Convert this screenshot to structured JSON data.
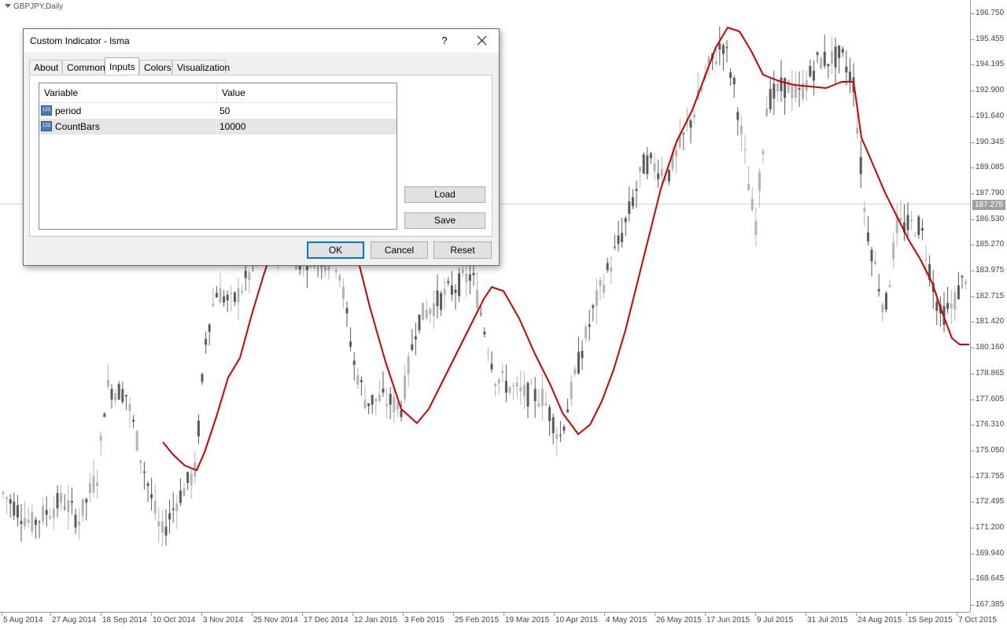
{
  "chart": {
    "symbol": "GBPJPY,Daily",
    "current_price": "187.275",
    "price_axis": [
      "196.750",
      "195.455",
      "194.195",
      "192.900",
      "191.640",
      "190.345",
      "189.085",
      "187.790",
      "186.530",
      "185.270",
      "183.975",
      "182.715",
      "181.420",
      "180.160",
      "178.865",
      "177.605",
      "176.310",
      "175.050",
      "173.755",
      "172.495",
      "171.200",
      "169.940",
      "168.645",
      "167.385"
    ],
    "time_axis": [
      "5 Aug 2014",
      "27 Aug 2014",
      "18 Sep 2014",
      "10 Oct 2014",
      "3 Nov 2014",
      "25 Nov 2014",
      "17 Dec 2014",
      "12 Jan 2015",
      "3 Feb 2015",
      "25 Feb 2015",
      "19 Mar 2015",
      "10 Apr 2015",
      "4 May 2015",
      "26 May 2015",
      "17 Jun 2015",
      "9 Jul 2015",
      "31 Jul 2015",
      "24 Aug 2015",
      "15 Sep 2015",
      "7 Oct 2015"
    ],
    "colors": {
      "candle": "#b4b4b4",
      "candle_bear": "#5a5a5a",
      "indicator": "#d00000",
      "axis": "#9a9a9a"
    }
  },
  "dialog": {
    "title": "Custom Indicator - lsma",
    "help_label": "?",
    "tabs": [
      {
        "label": "About"
      },
      {
        "label": "Common"
      },
      {
        "label": "Inputs",
        "active": true
      },
      {
        "label": "Colors"
      },
      {
        "label": "Visualization"
      }
    ],
    "table": {
      "columns": [
        "Variable",
        "Value"
      ],
      "rows": [
        {
          "variable": "period",
          "value": "50",
          "icon": "123"
        },
        {
          "variable": "CountBars",
          "value": "10000",
          "icon": "123",
          "selected": true
        }
      ]
    },
    "buttons": {
      "load": "Load",
      "save": "Save",
      "ok": "OK",
      "cancel": "Cancel",
      "reset": "Reset"
    }
  }
}
